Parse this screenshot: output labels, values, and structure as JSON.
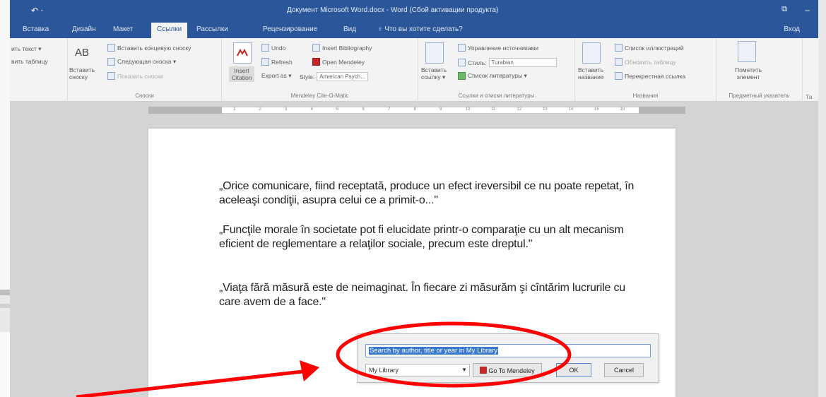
{
  "window": {
    "title": "Документ Microsoft Word.docx - Word (Сбой активации продукта)",
    "qat_label": "↶ ⋅",
    "restore_label": "⧉",
    "minimize_label": "–"
  },
  "tabs": [
    {
      "label": "Вставка"
    },
    {
      "label": "Дизайн"
    },
    {
      "label": "Макет"
    },
    {
      "label": "Ссылки",
      "active": true
    },
    {
      "label": "Рассылки"
    },
    {
      "label": "Рецензирование"
    },
    {
      "label": "Вид"
    },
    {
      "label": "♀ Что вы хотите сделать?"
    }
  ],
  "login_label": "Вход",
  "ribbon": {
    "toc": {
      "add_text": "ить текст ▾",
      "update_table": "вить таблицу"
    },
    "footnotes": {
      "insert_footnote_big": "AB",
      "insert_footnote": "Вставить сноску",
      "insert_endnote": "Вставить концевую сноску",
      "next_footnote": "Следующая сноска ▾",
      "show_notes": "Показать сноски",
      "group": "Сноски"
    },
    "mendeley": {
      "insert_citation": "Insert Citation",
      "undo": "Undo",
      "refresh": "Refresh",
      "export_as": "Export as ▾",
      "insert_bibliography": "Insert Bibliography",
      "open_mendeley": "Open Mendeley",
      "style_label": "Style:",
      "style_value": "American Psych...",
      "group": "Mendeley Cite-O-Matic"
    },
    "citations": {
      "insert_citation": "Вставить ссылку ▾",
      "manage_sources": "Управление источниками",
      "style_label": "Стиль:",
      "style_value": "Turabian",
      "bibliography": "Список литературы ▾",
      "group": "Ссылки и списки литературы"
    },
    "captions": {
      "insert_caption": "Вставить название",
      "table_of_figures": "Список иллюстраций",
      "update_table": "Обновить таблицу",
      "cross_reference": "Перекрестная ссылка",
      "group": "Названия"
    },
    "index": {
      "mark_entry": "Пометить элемент",
      "group": "Предметный указатель"
    },
    "extra_label": "Та"
  },
  "ruler_ticks": [
    "1",
    "2",
    "3",
    "4",
    "5",
    "6",
    "7",
    "8",
    "9",
    "10",
    "11",
    "12",
    "13",
    "14",
    "15",
    "16"
  ],
  "document": {
    "paragraphs": [
      "„Orice comunicare, fiind receptată, produce un efect  ireversibil ce nu poate repetat, în aceleaşi condiţii, asupra celui ce a primit-o...\"",
      "„Funcţile morale în societate pot fi elucidate printr-o comparaţie cu un alt mecanism  eficient de reglementare a relaţilor sociale, precum este dreptul.\"",
      "„Viaţa fără măsură este de neimaginat. În fiecare zi măsurăm şi cîntărim lucrurile cu care avem de a face.\""
    ]
  },
  "dialog": {
    "search_value": "Search by author, title or year in My Library",
    "library_value": "My Library",
    "dropdown_arrow": "▼",
    "go_to_mendeley": "Go To Mendeley",
    "ok": "OK",
    "cancel": "Cancel"
  },
  "colors": {
    "word_blue": "#2b579a",
    "annotation_red": "#ff0000"
  }
}
